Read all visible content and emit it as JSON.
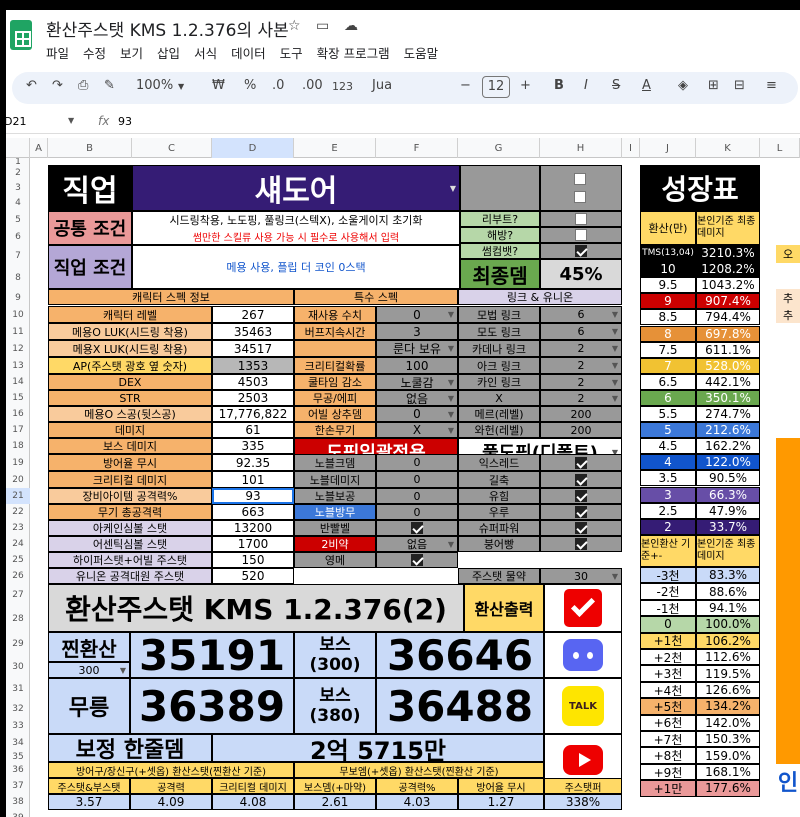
{
  "doc_title": "환산주스탯 KMS 1.2.376의 사본",
  "menu": [
    "파일",
    "수정",
    "보기",
    "삽입",
    "서식",
    "데이터",
    "도구",
    "확장 프로그램",
    "도움말"
  ],
  "toolbar": {
    "zoom": "100%",
    "won": "₩",
    "pct": "%",
    "dec0": ".0",
    "dec00": ".00",
    "fmt123": "123",
    "font": "Jua",
    "size": "12",
    "bold": "B",
    "italic": "I",
    "strike": "S",
    "textcolor": "A"
  },
  "formula": {
    "cellref": "D21",
    "fx": "fx",
    "value": "93"
  },
  "columns": [
    "A",
    "B",
    "C",
    "D",
    "E",
    "F",
    "G",
    "H",
    "I",
    "J",
    "K",
    "L"
  ],
  "rows": [
    "1",
    "2",
    "3",
    "4",
    "5",
    "6",
    "7",
    "8",
    "9",
    "10",
    "11",
    "12",
    "13",
    "14",
    "15",
    "16",
    "17",
    "18",
    "19",
    "20",
    "21",
    "22",
    "23",
    "24",
    "25",
    "26",
    "27",
    "28",
    "29",
    "30",
    "31",
    "32",
    "33",
    "34",
    "35",
    "36",
    "37",
    "38",
    "39",
    "40"
  ],
  "job": {
    "label": "직업",
    "value": "섀도어",
    "common_label": "공통 조건",
    "common_line1": "시드링착용, 노도핑, 풀링크(스텍X), 소울게이지 초기화",
    "common_line2": "썸만한 스킬류 사용 가능 시 필수로 사용해서 입력",
    "cond_label": "직업 조건",
    "cond_value": "메용 사용, 플립 더 코인 0스택"
  },
  "checks": {
    "reboot": "리부트?",
    "liberate": "해방?",
    "ssum": "썸컴뱃?",
    "final_label": "최종뎀",
    "final_value": "45%"
  },
  "spec_header": "캐릭터 스펙 정보",
  "spec": [
    {
      "k": "캐릭터 레벨",
      "v": "267"
    },
    {
      "k": "메용O LUK(시드링 착용)",
      "v": "35463"
    },
    {
      "k": "메용X LUK(시드링 착용)",
      "v": "34517"
    },
    {
      "k": "AP(주스탯 광호 옆 숫자)",
      "v": "1353"
    },
    {
      "k": "DEX",
      "v": "4503"
    },
    {
      "k": "STR",
      "v": "2503"
    },
    {
      "k": "메용O 스공(뒷스공)",
      "v": "17,776,822"
    },
    {
      "k": "데미지",
      "v": "61"
    },
    {
      "k": "보스 데미지",
      "v": "335"
    },
    {
      "k": "방어율 무시",
      "v": "92.35"
    },
    {
      "k": "크리티컬 데미지",
      "v": "101"
    },
    {
      "k": "장비아이템 공격력%",
      "v": "93"
    },
    {
      "k": "무기 총공격력",
      "v": "663"
    },
    {
      "k": "아케인심볼 스탯",
      "v": "13200"
    },
    {
      "k": "어센틱심볼 스탯",
      "v": "1700"
    },
    {
      "k": "하이퍼스탯+어빌 주스탯",
      "v": "150"
    },
    {
      "k": "유니온 공격대원 주스탯",
      "v": "520"
    }
  ],
  "special_header": "특수 스펙",
  "special": [
    {
      "k": "재사용 수치",
      "v": "0"
    },
    {
      "k": "버프지속시간",
      "v": "3"
    },
    {
      "k": "",
      "v": "룬다 보유"
    },
    {
      "k": "크리티컬확률",
      "v": "100"
    },
    {
      "k": "쿨타임 감소",
      "v": "노쿨감"
    },
    {
      "k": "무공/에피",
      "v": "없음"
    },
    {
      "k": "어빌 상추뎀",
      "v": "0"
    },
    {
      "k": "한손무기",
      "v": "X"
    }
  ],
  "doping_all": "도핑일괄적용",
  "full_doping": "풀도핑(디폴트)",
  "nobless": [
    {
      "k": "노블크뎀",
      "v": "0"
    },
    {
      "k": "노블데미지",
      "v": "0"
    },
    {
      "k": "노블보공",
      "v": "0"
    },
    {
      "k": "노블방무",
      "v": "0"
    },
    {
      "k": "반빨벨",
      "v": ""
    },
    {
      "k": "2비약",
      "v": "없음"
    },
    {
      "k": "영메",
      "v": ""
    }
  ],
  "link_header": "링크 & 유니온",
  "links": [
    {
      "k": "모법 링크",
      "v": "6"
    },
    {
      "k": "모도 링크",
      "v": "6"
    },
    {
      "k": "카데나 링크",
      "v": "2"
    },
    {
      "k": "아크 링크",
      "v": "2"
    },
    {
      "k": "카인 링크",
      "v": "2"
    },
    {
      "k": "X",
      "v": "2"
    },
    {
      "k": "메르(레벨)",
      "v": "200"
    },
    {
      "k": "와헌(레벨)",
      "v": "200"
    }
  ],
  "buffs": [
    {
      "k": "익스레드"
    },
    {
      "k": "길축"
    },
    {
      "k": "유힘"
    },
    {
      "k": "우루"
    },
    {
      "k": "슈퍼파워"
    },
    {
      "k": "붕어빵"
    }
  ],
  "mainstat_potion": {
    "k": "주스탯 물약",
    "v": "30"
  },
  "growth": {
    "title": "성장표",
    "h1": "환산(만)",
    "h2": "본인기준 최종데미지",
    "rows": [
      {
        "a": "TMS(13,04)",
        "b": "3210.3%"
      },
      {
        "a": "10",
        "b": "1208.2%"
      },
      {
        "a": "9.5",
        "b": "1043.2%"
      },
      {
        "a": "9",
        "b": "907.4%"
      },
      {
        "a": "8.5",
        "b": "794.4%"
      },
      {
        "a": "8",
        "b": "697.8%"
      },
      {
        "a": "7.5",
        "b": "611.1%"
      },
      {
        "a": "7",
        "b": "528.0%"
      },
      {
        "a": "6.5",
        "b": "442.1%"
      },
      {
        "a": "6",
        "b": "350.1%"
      },
      {
        "a": "5.5",
        "b": "274.7%"
      },
      {
        "a": "5",
        "b": "212.6%"
      },
      {
        "a": "4.5",
        "b": "162.2%"
      },
      {
        "a": "4",
        "b": "122.0%"
      },
      {
        "a": "3.5",
        "b": "90.5%"
      },
      {
        "a": "3",
        "b": "66.3%"
      },
      {
        "a": "2.5",
        "b": "47.9%"
      },
      {
        "a": "2",
        "b": "33.7%"
      }
    ],
    "h3": "본인환산 기준+-",
    "h4": "본인기준 최종데미지",
    "rows2": [
      {
        "a": "-3천",
        "b": "83.3%"
      },
      {
        "a": "-2천",
        "b": "88.6%"
      },
      {
        "a": "-1천",
        "b": "94.1%"
      },
      {
        "a": "0",
        "b": "100.0%"
      },
      {
        "a": "+1천",
        "b": "106.2%"
      },
      {
        "a": "+2천",
        "b": "112.6%"
      },
      {
        "a": "+3천",
        "b": "119.5%"
      },
      {
        "a": "+4천",
        "b": "126.6%"
      },
      {
        "a": "+5천",
        "b": "134.2%"
      },
      {
        "a": "+6천",
        "b": "142.0%"
      },
      {
        "a": "+7천",
        "b": "150.3%"
      },
      {
        "a": "+8천",
        "b": "159.0%"
      },
      {
        "a": "+9천",
        "b": "168.1%"
      },
      {
        "a": "+1만",
        "b": "177.6%"
      }
    ]
  },
  "result": {
    "title": "환산주스탯 KMS 1.2.376(2)",
    "export": "환산출력",
    "jjin_label": "찐환산",
    "jjin_level": "300",
    "jjin_value": "35191",
    "boss300_label1": "보스",
    "boss300_label2": "(300)",
    "boss300_value": "36646",
    "mureung_label": "무릉",
    "mureung_value": "36389",
    "boss380_label1": "보스",
    "boss380_label2": "(380)",
    "boss380_value": "36488",
    "hanjul_label": "보정 한줄뎀",
    "hanjul_value": "2억 5715만",
    "eff_h1": "방어구/장신구(+셋옵) 환산스탯(찐환산 기준)",
    "eff_h2": "무보엠(+셋옵) 환산스탯(찐환산 기준)",
    "eff_h3": "주스탯퍼",
    "eff_labels": [
      "주스탯&부스탯",
      "공격력",
      "크리티컬 데미지",
      "보스뎀(+마약)",
      "공격력%",
      "방어율 무시"
    ],
    "eff_values": [
      "3.57",
      "4.09",
      "4.08",
      "2.61",
      "4.03",
      "1.27"
    ],
    "mainstat_pct": "338%"
  },
  "side_partial": [
    "오",
    "추",
    "추",
    "인"
  ],
  "icons": {
    "kakao": "TALK"
  }
}
